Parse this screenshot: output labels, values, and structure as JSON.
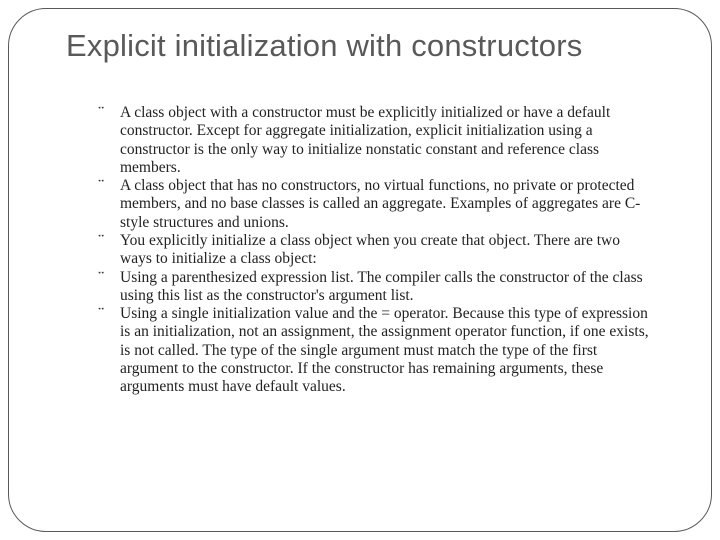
{
  "slide": {
    "title": "Explicit initialization with constructors",
    "bullets": [
      "A class object with a constructor must be explicitly initialized or have a default constructor. Except for aggregate initialization, explicit initialization using a constructor is the only way to initialize nonstatic constant and reference class members.",
      "A class object that has no constructors, no virtual functions, no private or protected members, and no base classes is called an aggregate. Examples of aggregates are C-style structures and unions.",
      "You explicitly initialize a class object when you create that object. There are two ways to initialize a class object:",
      "Using a parenthesized expression list. The compiler calls the constructor of the class using this list as the constructor's argument list.",
      "Using a single initialization value and the = operator. Because this type of expression is an initialization, not an assignment, the assignment operator function, if one exists, is not called. The type of the single argument must match the type of the first argument to the constructor. If the constructor has remaining arguments, these arguments must have default values."
    ],
    "bullet_marker": "་"
  }
}
